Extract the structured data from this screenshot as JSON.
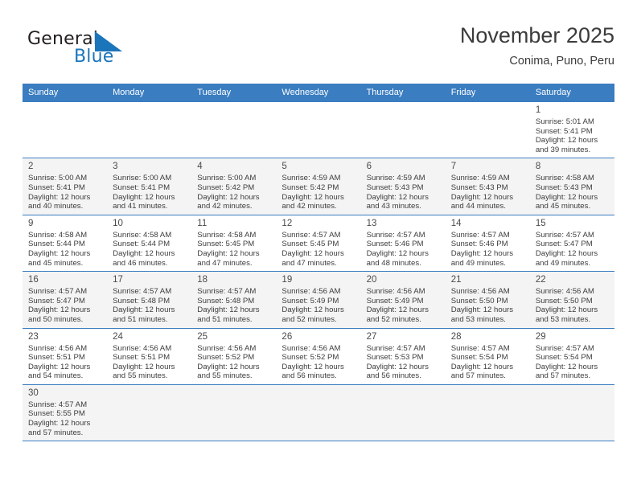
{
  "brand": {
    "name_top": "General",
    "name_bottom": "Blue",
    "flag_icon": "blue-triangle-flag-icon",
    "color_dark": "#231f20",
    "color_blue": "#1b75bb"
  },
  "header": {
    "month_title": "November 2025",
    "location": "Conima, Puno, Peru"
  },
  "theme": {
    "header_bg": "#3a7dc0",
    "header_text": "#ffffff",
    "row_shade": "#f4f4f4",
    "grid_line": "#3a7dc0"
  },
  "weekday_headers": [
    "Sunday",
    "Monday",
    "Tuesday",
    "Wednesday",
    "Thursday",
    "Friday",
    "Saturday"
  ],
  "weeks": [
    {
      "shaded": false,
      "days": [
        {
          "day": "",
          "detail": ""
        },
        {
          "day": "",
          "detail": ""
        },
        {
          "day": "",
          "detail": ""
        },
        {
          "day": "",
          "detail": ""
        },
        {
          "day": "",
          "detail": ""
        },
        {
          "day": "",
          "detail": ""
        },
        {
          "day": "1",
          "detail": "Sunrise: 5:01 AM\nSunset: 5:41 PM\nDaylight: 12 hours\nand 39 minutes."
        }
      ]
    },
    {
      "shaded": true,
      "days": [
        {
          "day": "2",
          "detail": "Sunrise: 5:00 AM\nSunset: 5:41 PM\nDaylight: 12 hours\nand 40 minutes."
        },
        {
          "day": "3",
          "detail": "Sunrise: 5:00 AM\nSunset: 5:41 PM\nDaylight: 12 hours\nand 41 minutes."
        },
        {
          "day": "4",
          "detail": "Sunrise: 5:00 AM\nSunset: 5:42 PM\nDaylight: 12 hours\nand 42 minutes."
        },
        {
          "day": "5",
          "detail": "Sunrise: 4:59 AM\nSunset: 5:42 PM\nDaylight: 12 hours\nand 42 minutes."
        },
        {
          "day": "6",
          "detail": "Sunrise: 4:59 AM\nSunset: 5:43 PM\nDaylight: 12 hours\nand 43 minutes."
        },
        {
          "day": "7",
          "detail": "Sunrise: 4:59 AM\nSunset: 5:43 PM\nDaylight: 12 hours\nand 44 minutes."
        },
        {
          "day": "8",
          "detail": "Sunrise: 4:58 AM\nSunset: 5:43 PM\nDaylight: 12 hours\nand 45 minutes."
        }
      ]
    },
    {
      "shaded": false,
      "days": [
        {
          "day": "9",
          "detail": "Sunrise: 4:58 AM\nSunset: 5:44 PM\nDaylight: 12 hours\nand 45 minutes."
        },
        {
          "day": "10",
          "detail": "Sunrise: 4:58 AM\nSunset: 5:44 PM\nDaylight: 12 hours\nand 46 minutes."
        },
        {
          "day": "11",
          "detail": "Sunrise: 4:58 AM\nSunset: 5:45 PM\nDaylight: 12 hours\nand 47 minutes."
        },
        {
          "day": "12",
          "detail": "Sunrise: 4:57 AM\nSunset: 5:45 PM\nDaylight: 12 hours\nand 47 minutes."
        },
        {
          "day": "13",
          "detail": "Sunrise: 4:57 AM\nSunset: 5:46 PM\nDaylight: 12 hours\nand 48 minutes."
        },
        {
          "day": "14",
          "detail": "Sunrise: 4:57 AM\nSunset: 5:46 PM\nDaylight: 12 hours\nand 49 minutes."
        },
        {
          "day": "15",
          "detail": "Sunrise: 4:57 AM\nSunset: 5:47 PM\nDaylight: 12 hours\nand 49 minutes."
        }
      ]
    },
    {
      "shaded": true,
      "days": [
        {
          "day": "16",
          "detail": "Sunrise: 4:57 AM\nSunset: 5:47 PM\nDaylight: 12 hours\nand 50 minutes."
        },
        {
          "day": "17",
          "detail": "Sunrise: 4:57 AM\nSunset: 5:48 PM\nDaylight: 12 hours\nand 51 minutes."
        },
        {
          "day": "18",
          "detail": "Sunrise: 4:57 AM\nSunset: 5:48 PM\nDaylight: 12 hours\nand 51 minutes."
        },
        {
          "day": "19",
          "detail": "Sunrise: 4:56 AM\nSunset: 5:49 PM\nDaylight: 12 hours\nand 52 minutes."
        },
        {
          "day": "20",
          "detail": "Sunrise: 4:56 AM\nSunset: 5:49 PM\nDaylight: 12 hours\nand 52 minutes."
        },
        {
          "day": "21",
          "detail": "Sunrise: 4:56 AM\nSunset: 5:50 PM\nDaylight: 12 hours\nand 53 minutes."
        },
        {
          "day": "22",
          "detail": "Sunrise: 4:56 AM\nSunset: 5:50 PM\nDaylight: 12 hours\nand 53 minutes."
        }
      ]
    },
    {
      "shaded": false,
      "days": [
        {
          "day": "23",
          "detail": "Sunrise: 4:56 AM\nSunset: 5:51 PM\nDaylight: 12 hours\nand 54 minutes."
        },
        {
          "day": "24",
          "detail": "Sunrise: 4:56 AM\nSunset: 5:51 PM\nDaylight: 12 hours\nand 55 minutes."
        },
        {
          "day": "25",
          "detail": "Sunrise: 4:56 AM\nSunset: 5:52 PM\nDaylight: 12 hours\nand 55 minutes."
        },
        {
          "day": "26",
          "detail": "Sunrise: 4:56 AM\nSunset: 5:52 PM\nDaylight: 12 hours\nand 56 minutes."
        },
        {
          "day": "27",
          "detail": "Sunrise: 4:57 AM\nSunset: 5:53 PM\nDaylight: 12 hours\nand 56 minutes."
        },
        {
          "day": "28",
          "detail": "Sunrise: 4:57 AM\nSunset: 5:54 PM\nDaylight: 12 hours\nand 57 minutes."
        },
        {
          "day": "29",
          "detail": "Sunrise: 4:57 AM\nSunset: 5:54 PM\nDaylight: 12 hours\nand 57 minutes."
        }
      ]
    },
    {
      "shaded": true,
      "days": [
        {
          "day": "30",
          "detail": "Sunrise: 4:57 AM\nSunset: 5:55 PM\nDaylight: 12 hours\nand 57 minutes."
        },
        {
          "day": "",
          "detail": ""
        },
        {
          "day": "",
          "detail": ""
        },
        {
          "day": "",
          "detail": ""
        },
        {
          "day": "",
          "detail": ""
        },
        {
          "day": "",
          "detail": ""
        },
        {
          "day": "",
          "detail": ""
        }
      ]
    }
  ]
}
